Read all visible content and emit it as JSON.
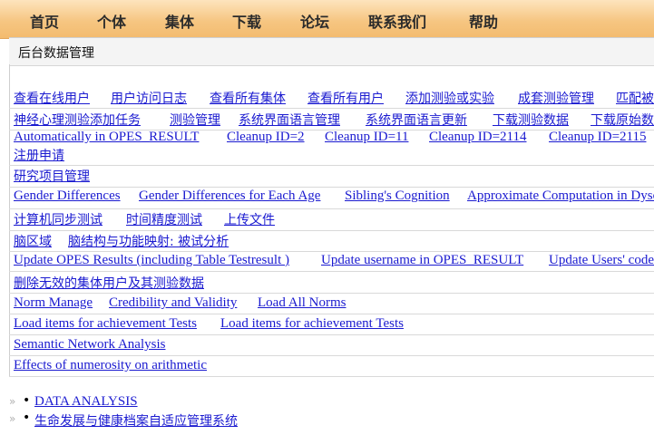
{
  "nav": [
    "首页",
    "个体",
    "集体",
    "下载",
    "论坛",
    "联系我们",
    "帮助"
  ],
  "section": {
    "title": "后台数据管理"
  },
  "rows": [
    [
      "查看在线用户",
      "用户访问日志",
      "查看所有集体",
      "查看所有用户",
      "添加测验或实验",
      "成套测验管理",
      "匹配被试"
    ],
    [
      "神经心理测验添加任务",
      "测验管理",
      "系统界面语言管理",
      "系统界面语言更新",
      "下载测验数据",
      "下载原始数据"
    ],
    [
      "Automatically in OPES_RESULT",
      "Cleanup ID=2",
      "Cleanup ID=11",
      "Cleanup ID=2114",
      "Cleanup ID=2115"
    ],
    [
      "注册申请"
    ],
    [
      "研究项目管理"
    ],
    [
      "Gender Differences",
      "Gender Differences for Each Age",
      "Sibling's Cognition",
      "Approximate Computation in Dyscalculia"
    ],
    [
      "计算机同步测试",
      "时间精度测试",
      "上传文件"
    ],
    [
      "脑区域",
      "脑结构与功能映射: 被试分析"
    ],
    [
      "Update OPES Results (including Table Testresult )",
      "Update username in OPES_RESULT",
      "Update Users' code"
    ],
    [
      "删除无效的集体用户及其测验数据"
    ],
    [
      "Norm Manage",
      "Credibility and Validity",
      "Load All Norms"
    ],
    [
      "Load items for achievement Tests",
      "Load items for achievement Tests"
    ],
    [
      "Semantic Network Analysis"
    ],
    [
      "Effects of numerosity on arithmetic"
    ]
  ],
  "bottom_links": [
    "DATA ANALYSIS",
    "生命发展与健康档案自适应管理系统"
  ],
  "colors": {
    "link": "#1a1ad0",
    "nav_bg": "#f6c682",
    "nav_text": "#2b2b2b"
  }
}
